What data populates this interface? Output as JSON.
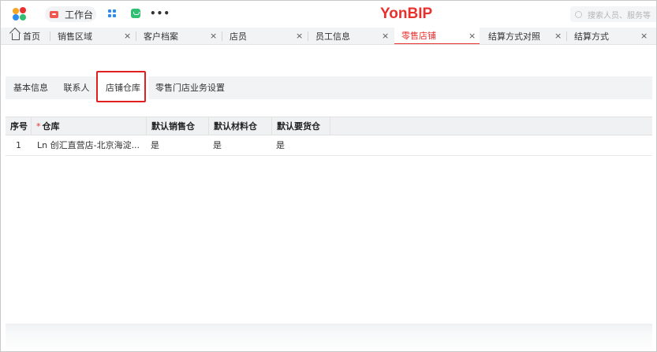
{
  "topbar": {
    "workspace_label": "工作台",
    "brand": "YonBIP",
    "search_placeholder": "搜索人员、服务等",
    "icons": [
      "app-logo-icon",
      "workbench-icon",
      "apps-grid-icon",
      "message-icon",
      "more-icon",
      "search-icon"
    ],
    "brand_color": "#e8312e"
  },
  "tabs": [
    {
      "label": "首页",
      "closable": false
    },
    {
      "label": "销售区域",
      "closable": true
    },
    {
      "label": "客户档案",
      "closable": true
    },
    {
      "label": "店员",
      "closable": true
    },
    {
      "label": "员工信息",
      "closable": true
    },
    {
      "label": "零售店铺",
      "closable": true,
      "active": true
    },
    {
      "label": "结算方式对照",
      "closable": true
    },
    {
      "label": "结算方式",
      "closable": true
    }
  ],
  "close_glyph": "×",
  "subtabs": [
    {
      "label": "基本信息"
    },
    {
      "label": "联系人"
    },
    {
      "label": "店铺仓库",
      "selected": true
    },
    {
      "label": "零售门店业务设置"
    }
  ],
  "table": {
    "required_mark": "*",
    "columns": [
      "序号",
      "仓库",
      "默认销售仓",
      "默认材料仓",
      "默认要货仓"
    ],
    "rows": [
      [
        "1",
        "Ln 创汇直营店-北京海淀...",
        "是",
        "是",
        "是"
      ]
    ]
  }
}
